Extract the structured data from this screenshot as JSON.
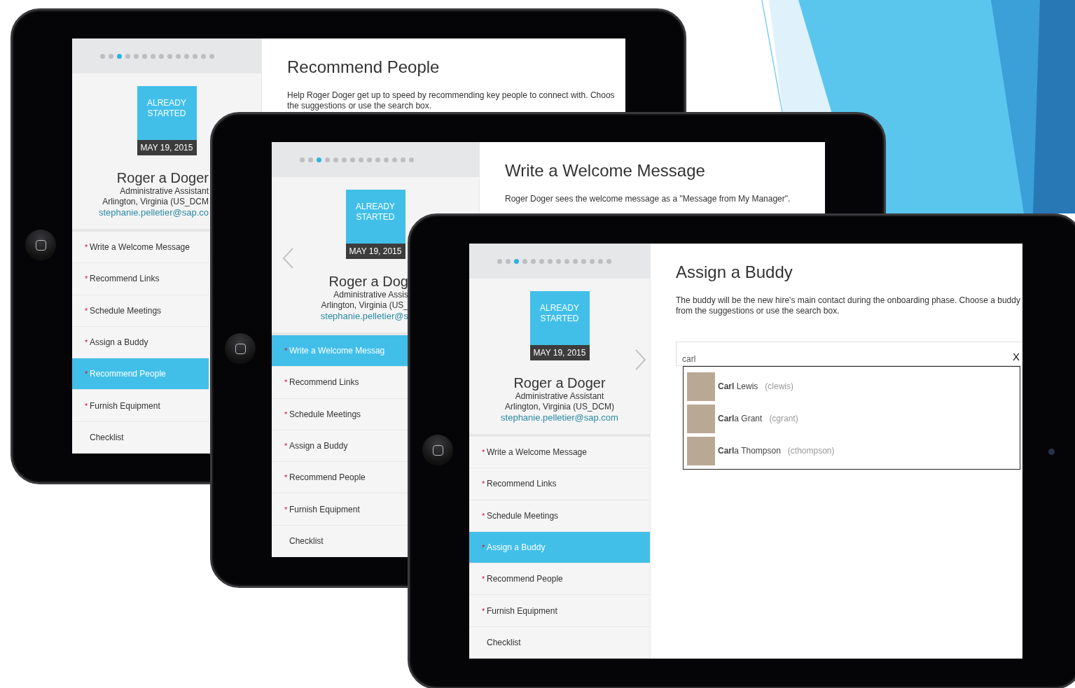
{
  "tablets": [
    {
      "pager": [
        {
          "selected": false
        },
        {
          "selected": false
        },
        {
          "selected": true
        },
        {
          "selected": false
        },
        {
          "selected": false
        },
        {
          "selected": false
        },
        {
          "selected": false
        },
        {
          "selected": false
        },
        {
          "selected": false
        },
        {
          "selected": false
        },
        {
          "selected": false
        },
        {
          "selected": false
        },
        {
          "selected": false
        },
        {
          "selected": false
        }
      ],
      "status": {
        "label": "ALREADY STARTED",
        "date": "MAY 19, 2015"
      },
      "profile": {
        "name": "Roger a Doger",
        "title": "Administrative Assistant",
        "location": "Arlington, Virginia (US_DCM",
        "email": "stephanie.pelletier@sap.co"
      },
      "nav": [
        {
          "mark": "*",
          "label": "Write a Welcome Message",
          "selected": false
        },
        {
          "mark": "*",
          "label": "Recommend Links",
          "selected": false
        },
        {
          "mark": "*",
          "label": "Schedule Meetings",
          "selected": false
        },
        {
          "mark": "*",
          "label": "Assign a Buddy",
          "selected": false
        },
        {
          "mark": "*",
          "label": "Recommend People",
          "selected": true
        },
        {
          "mark": "*",
          "label": "Furnish Equipment",
          "selected": false
        },
        {
          "label": "Checklist",
          "selected": false
        }
      ],
      "main": {
        "title": "Recommend People",
        "description_lines": [
          "Help Roger Doger get up to speed by recommending key people to connect with. Choos",
          "the suggestions or use the search box."
        ]
      }
    },
    {
      "pager": [
        {
          "selected": false
        },
        {
          "selected": false
        },
        {
          "selected": true
        },
        {
          "selected": false
        },
        {
          "selected": false
        },
        {
          "selected": false
        },
        {
          "selected": false
        },
        {
          "selected": false
        },
        {
          "selected": false
        },
        {
          "selected": false
        },
        {
          "selected": false
        },
        {
          "selected": false
        },
        {
          "selected": false
        },
        {
          "selected": false
        }
      ],
      "previous_arrow": true,
      "status": {
        "label": "ALREADY STARTED",
        "date": "MAY 19, 2015"
      },
      "profile": {
        "name": "Roger a Dog",
        "title": "Administrative Assis",
        "location": "Arlington, Virginia (US_",
        "email": "stephanie.pelletier@s"
      },
      "nav": [
        {
          "mark": "*",
          "label": "Write a Welcome Messag",
          "selected": true
        },
        {
          "mark": "*",
          "label": "Recommend Links",
          "selected": false
        },
        {
          "mark": "*",
          "label": "Schedule Meetings",
          "selected": false
        },
        {
          "mark": "*",
          "label": "Assign a Buddy",
          "selected": false
        },
        {
          "mark": "*",
          "label": "Recommend People",
          "selected": false
        },
        {
          "mark": "*",
          "label": "Furnish Equipment",
          "selected": false
        },
        {
          "label": "Checklist",
          "selected": false
        }
      ],
      "main": {
        "title": "Write a Welcome Message",
        "description_lines": [
          "Roger Doger sees the welcome message as a \"Message from My Manager\"."
        ]
      }
    },
    {
      "pager": [
        {
          "selected": false
        },
        {
          "selected": false
        },
        {
          "selected": true
        },
        {
          "selected": false
        },
        {
          "selected": false
        },
        {
          "selected": false
        },
        {
          "selected": false
        },
        {
          "selected": false
        },
        {
          "selected": false
        },
        {
          "selected": false
        },
        {
          "selected": false
        },
        {
          "selected": false
        },
        {
          "selected": false
        },
        {
          "selected": false
        }
      ],
      "next_arrow": true,
      "status": {
        "label": "ALREADY STARTED",
        "date": "MAY 19, 2015"
      },
      "profile": {
        "name": "Roger a Doger",
        "title": "Administrative Assistant",
        "location": "Arlington, Virginia (US_DCM)",
        "email": "stephanie.pelletier@sap.com"
      },
      "nav": [
        {
          "mark": "*",
          "label": "Write a Welcome Message",
          "selected": false
        },
        {
          "mark": "*",
          "label": "Recommend Links",
          "selected": false
        },
        {
          "mark": "*",
          "label": "Schedule Meetings",
          "selected": false
        },
        {
          "mark": "*",
          "label": "Assign a Buddy",
          "selected": true
        },
        {
          "mark": "*",
          "label": "Recommend People",
          "selected": false
        },
        {
          "mark": "*",
          "label": "Furnish Equipment",
          "selected": false
        },
        {
          "label": "Checklist",
          "selected": false
        }
      ],
      "main": {
        "title": "Assign a Buddy",
        "description_lines": [
          "The buddy will be the new hire's main contact during the onboarding phase. Choose a buddy",
          "from the suggestions or use the search box."
        ],
        "search": {
          "value": "carl",
          "clear": "X"
        },
        "results": [
          {
            "name": "**Carl** Lewis",
            "username": "(clewis)"
          },
          {
            "name": "**Carl**a Grant",
            "username": "(cgrant)"
          },
          {
            "name": "**Carl**a Thompson",
            "username": "(cthompson)"
          }
        ]
      }
    }
  ]
}
